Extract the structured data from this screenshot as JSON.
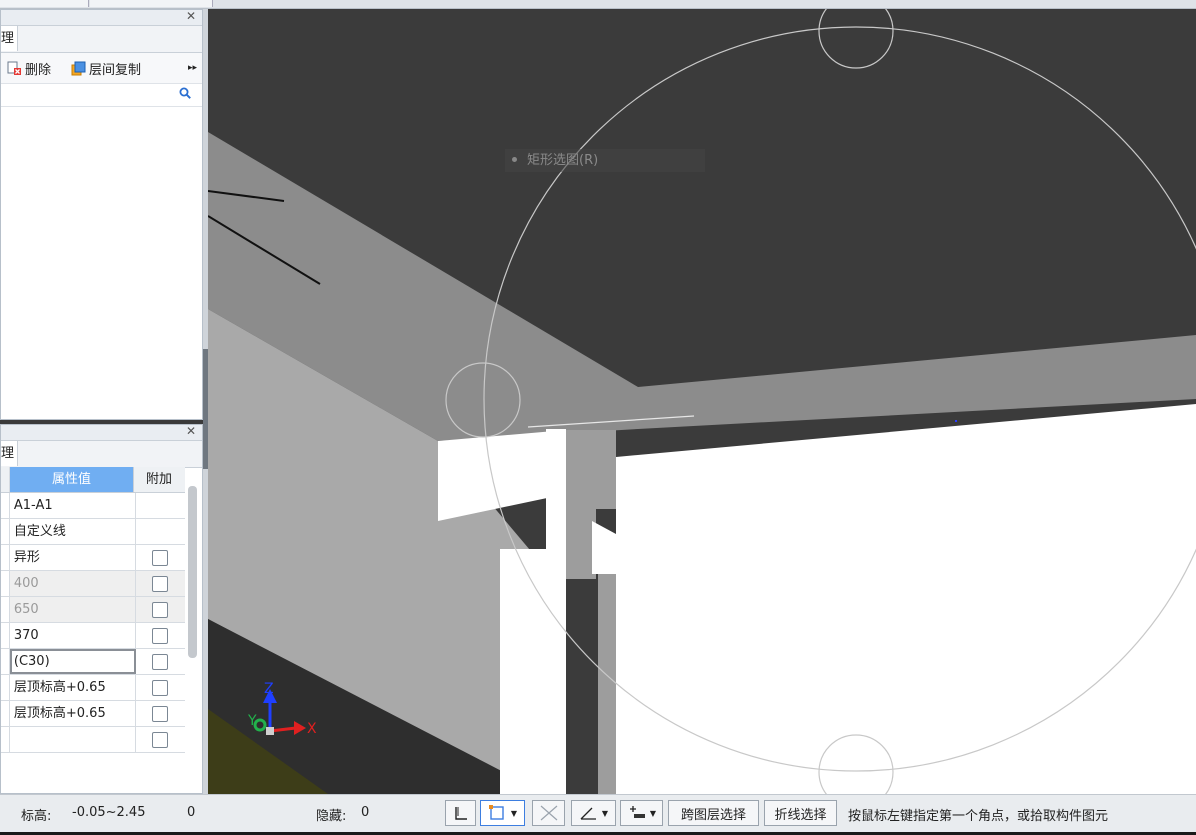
{
  "upper_panel": {
    "tab_label": "理",
    "toolbar": {
      "delete_label": "删除",
      "copy_label": "层间复制",
      "more_glyph": "▸▸"
    },
    "search_placeholder": ""
  },
  "property_panel": {
    "tab_label": "理",
    "columns": {
      "value": "属性值",
      "attach": "附加"
    },
    "rows": [
      {
        "value": "A1-A1",
        "checkbox": false,
        "greyed": false,
        "selected": false
      },
      {
        "value": "自定义线",
        "checkbox": false,
        "greyed": false,
        "selected": false
      },
      {
        "value": "异形",
        "checkbox": true,
        "greyed": false,
        "selected": false
      },
      {
        "value": "400",
        "checkbox": true,
        "greyed": true,
        "selected": false
      },
      {
        "value": "650",
        "checkbox": true,
        "greyed": true,
        "selected": false
      },
      {
        "value": "370",
        "checkbox": true,
        "greyed": false,
        "selected": false
      },
      {
        "value": "(C30)",
        "checkbox": true,
        "greyed": false,
        "selected": true
      },
      {
        "value": "层顶标高+0.65",
        "checkbox": true,
        "greyed": false,
        "selected": false
      },
      {
        "value": "层顶标高+0.65",
        "checkbox": true,
        "greyed": false,
        "selected": false
      },
      {
        "value": "",
        "checkbox": true,
        "greyed": false,
        "selected": false
      }
    ]
  },
  "viewport": {
    "context_menu_item": "矩形选图(R)",
    "axis_labels": {
      "x": "X",
      "y": "Y",
      "z": "Z"
    }
  },
  "status_bar": {
    "elevation_label": "标高:",
    "elevation_value": "-0.05~2.45",
    "count_value": "0",
    "hidden_label": "隐藏:",
    "hidden_value": "0",
    "cross_layer_select": "跨图层选择",
    "polyline_select": "折线选择",
    "hint": "按鼠标左键指定第一个角点，或拾取构件图元"
  },
  "colors": {
    "header_blue": "#70aef2",
    "viewport_bg": "#3b3b3b",
    "axis_x": "#e02020",
    "axis_y": "#22b14c",
    "axis_z": "#1f3fff"
  }
}
